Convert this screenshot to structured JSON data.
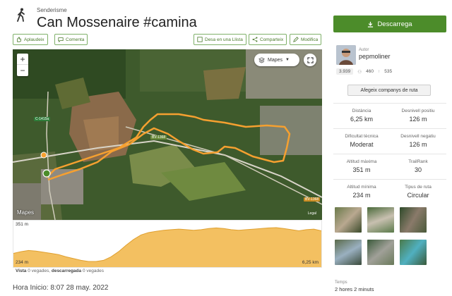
{
  "header": {
    "category": "Senderisme",
    "title": "Can Mossenaire #camina"
  },
  "actions": {
    "applaud": "Aplaudeix",
    "comment": "Comenta",
    "save_list": "Desa en una Llista",
    "share": "Comparteix",
    "edit": "Modifica"
  },
  "map": {
    "layers_label": "Mapes",
    "roads": [
      "C-1415a",
      "BV-1368",
      "BV-1368"
    ],
    "watermark": "Mapes",
    "legal": "Legal"
  },
  "elevation": {
    "max_label": "351 m",
    "min_label": "234 m",
    "distance_label": "6,25 km",
    "profile": [
      262,
      268,
      272,
      270,
      266,
      262,
      258,
      250,
      244,
      238,
      234,
      234,
      238,
      250,
      268,
      290,
      310,
      326,
      334,
      338,
      342,
      344,
      346,
      344,
      342,
      344,
      348,
      350,
      348,
      344,
      342,
      344,
      346,
      348,
      350,
      351,
      348,
      344,
      340,
      344,
      346,
      340
    ]
  },
  "stats_line": {
    "view_label": "Vista",
    "view_value": "0 vegades",
    "download_label": "descarregada",
    "download_value": "0 vegades"
  },
  "start_time": "Hora Inicio: 8:07 28 may. 2022",
  "sidebar": {
    "download_button": "Descarrega",
    "author_label": "Autor",
    "author_name": "pepmoliner",
    "author_score": "3.939",
    "author_followers": "460",
    "author_trails": "535",
    "add_partners": "Afegeix companys de ruta",
    "stats": [
      {
        "key": "Distància",
        "value": "6,25 km"
      },
      {
        "key": "Desnivell positiu",
        "value": "126 m"
      },
      {
        "key": "Dificultat tècnica",
        "value": "Moderat"
      },
      {
        "key": "Desnivell negatiu",
        "value": "126 m"
      },
      {
        "key": "Altitud màxima",
        "value": "351 m"
      },
      {
        "key": "TrailRank",
        "value": "30"
      },
      {
        "key": "Altitud mínima",
        "value": "234 m"
      },
      {
        "key": "Tipus de ruta",
        "value": "Circular"
      }
    ],
    "time_label": "Temps",
    "time_value": "2 hores 2 minuts"
  },
  "colors": {
    "accent_green": "#4c8c2a",
    "track_orange": "#f5a030",
    "elevation_fill": "#f3c061"
  }
}
